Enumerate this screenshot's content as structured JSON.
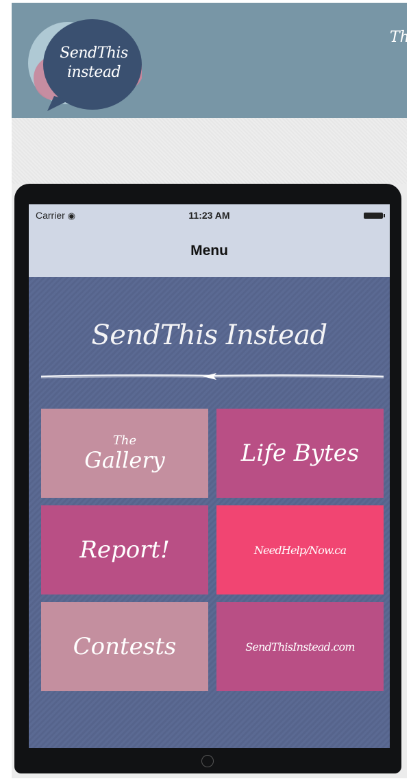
{
  "site": {
    "logo_line1": "SendThis",
    "logo_line2": "instead",
    "header_cut_text": "Th"
  },
  "device": {
    "status": {
      "carrier": "Carrier",
      "time": "11:23 AM"
    },
    "nav_title": "Menu",
    "app_title": "SendThis Instead",
    "tiles": [
      {
        "line1": "The",
        "line2": "Gallery",
        "color": "#c48f9f"
      },
      {
        "label": "Life Bytes",
        "color": "#b94f85"
      },
      {
        "label": "Report!",
        "color": "#b94f85"
      },
      {
        "label": "NeedHelp/Now.ca",
        "color": "#f14572"
      },
      {
        "label": "Contests",
        "color": "#c48f9f"
      },
      {
        "label": "SendThisInstead.com",
        "color": "#b94f85"
      }
    ]
  },
  "colors": {
    "header": "#7896a6",
    "screen_bg": "#5a6890",
    "nav_bar": "#d0d7e5"
  }
}
